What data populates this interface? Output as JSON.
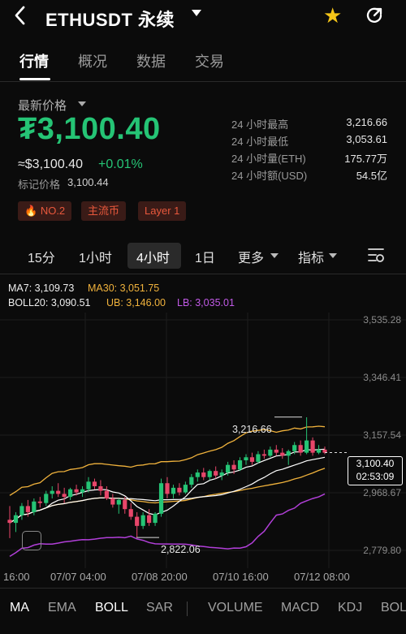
{
  "header": {
    "back_icon": "chevron-left-icon",
    "title": "ETHUSDT 永续",
    "star_color": "#f5c518"
  },
  "tabs": [
    "行情",
    "概况",
    "数据",
    "交易"
  ],
  "price": {
    "label": "最新价格",
    "main": "₮3,100.40",
    "usd": "≈$3,100.40",
    "change": "+0.01%",
    "mark_label": "标记价格",
    "mark_value": "3,100.44",
    "color_up": "#25c475"
  },
  "stats": [
    {
      "label": "24 小时最高",
      "value": "3,216.66"
    },
    {
      "label": "24 小时最低",
      "value": "3,053.61"
    },
    {
      "label": "24 小时量(ETH)",
      "value": "175.77万"
    },
    {
      "label": "24 小时额(USD)",
      "value": "54.5亿"
    }
  ],
  "badges": [
    "NO.2",
    "主流币",
    "Layer 1"
  ],
  "timeframes": [
    "15分",
    "1小时",
    "4小时",
    "1日",
    "更多",
    "指标"
  ],
  "legend": {
    "ma7": "MA7: 3,109.73",
    "ma30": "MA30: 3,051.75",
    "boll": "BOLL20: 3,090.51",
    "ub": "UB: 3,146.00",
    "lb": "LB: 3,035.01"
  },
  "axis": [
    "3,535.28",
    "3,346.41",
    "3,157.54",
    "2,968.67",
    "2,779.80"
  ],
  "annotations": {
    "high": "3,216.66",
    "low": "2,822.06"
  },
  "last_price": {
    "price": "3,100.40",
    "countdown": "02:53:09"
  },
  "dates": [
    "16:00",
    "07/07 04:00",
    "07/08 20:00",
    "07/10 16:00",
    "07/12 08:00"
  ],
  "indicators": [
    "MA",
    "EMA",
    "BOLL",
    "SAR",
    "VOLUME",
    "MACD",
    "KDJ",
    "BOLL"
  ],
  "colors": {
    "up": "#25c475",
    "down": "#e8466a",
    "ma7": "#ffffff",
    "ma30": "#f0b23c",
    "lb": "#b13fd8"
  },
  "candles": [
    [
      2880,
      2925,
      2820,
      2870
    ],
    [
      2870,
      2905,
      2840,
      2895
    ],
    [
      2895,
      2935,
      2880,
      2925
    ],
    [
      2925,
      2945,
      2890,
      2905
    ],
    [
      2905,
      2950,
      2895,
      2940
    ],
    [
      2940,
      2955,
      2920,
      2935
    ],
    [
      2935,
      2975,
      2925,
      2965
    ],
    [
      2965,
      2990,
      2950,
      2975
    ],
    [
      2975,
      3000,
      2955,
      2965
    ],
    [
      2965,
      2985,
      2935,
      2955
    ],
    [
      2955,
      2985,
      2945,
      2980
    ],
    [
      2980,
      2995,
      2960,
      2970
    ],
    [
      2970,
      2990,
      2955,
      2980
    ],
    [
      2980,
      3020,
      2970,
      3005
    ],
    [
      3005,
      3015,
      2980,
      2990
    ],
    [
      2990,
      3010,
      2960,
      2975
    ],
    [
      2975,
      2990,
      2945,
      2950
    ],
    [
      2950,
      2965,
      2920,
      2930
    ],
    [
      2930,
      2950,
      2900,
      2945
    ],
    [
      2945,
      2955,
      2900,
      2915
    ],
    [
      2915,
      2935,
      2880,
      2890
    ],
    [
      2890,
      2905,
      2822,
      2860
    ],
    [
      2860,
      2905,
      2850,
      2895
    ],
    [
      2895,
      2915,
      2860,
      2870
    ],
    [
      2870,
      2905,
      2860,
      2900
    ],
    [
      2900,
      3015,
      2890,
      3000
    ],
    [
      3000,
      3020,
      2950,
      2965
    ],
    [
      2965,
      2995,
      2950,
      2985
    ],
    [
      2985,
      3000,
      2960,
      2970
    ],
    [
      2970,
      3005,
      2965,
      2995
    ],
    [
      2995,
      3030,
      2985,
      3020
    ],
    [
      3020,
      3045,
      3005,
      3035
    ],
    [
      3035,
      3050,
      3010,
      3020
    ],
    [
      3020,
      3045,
      3010,
      3040
    ],
    [
      3040,
      3055,
      3015,
      3025
    ],
    [
      3025,
      3045,
      3010,
      3035
    ],
    [
      3035,
      3070,
      3025,
      3060
    ],
    [
      3060,
      3075,
      3030,
      3045
    ],
    [
      3045,
      3085,
      3040,
      3075
    ],
    [
      3075,
      3095,
      3060,
      3085
    ],
    [
      3085,
      3100,
      3060,
      3070
    ],
    [
      3070,
      3105,
      3065,
      3095
    ],
    [
      3095,
      3110,
      3080,
      3090
    ],
    [
      3090,
      3120,
      3085,
      3110
    ],
    [
      3110,
      3125,
      3090,
      3100
    ],
    [
      3100,
      3115,
      3080,
      3090
    ],
    [
      3090,
      3110,
      3060,
      3105
    ],
    [
      3105,
      3135,
      3095,
      3125
    ],
    [
      3125,
      3140,
      3090,
      3100
    ],
    [
      3100,
      3216,
      3095,
      3140
    ],
    [
      3140,
      3150,
      3090,
      3100
    ],
    [
      3100,
      3125,
      3095,
      3110
    ],
    [
      3110,
      3120,
      3095,
      3100
    ]
  ]
}
